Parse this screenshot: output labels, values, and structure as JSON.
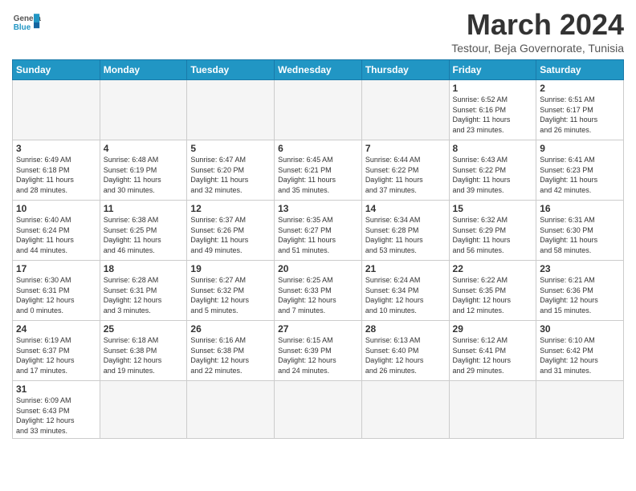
{
  "header": {
    "logo_general": "General",
    "logo_blue": "Blue",
    "month_title": "March 2024",
    "subtitle": "Testour, Beja Governorate, Tunisia"
  },
  "days_of_week": [
    "Sunday",
    "Monday",
    "Tuesday",
    "Wednesday",
    "Thursday",
    "Friday",
    "Saturday"
  ],
  "weeks": [
    [
      {
        "day": "",
        "info": ""
      },
      {
        "day": "",
        "info": ""
      },
      {
        "day": "",
        "info": ""
      },
      {
        "day": "",
        "info": ""
      },
      {
        "day": "",
        "info": ""
      },
      {
        "day": "1",
        "info": "Sunrise: 6:52 AM\nSunset: 6:16 PM\nDaylight: 11 hours\nand 23 minutes."
      },
      {
        "day": "2",
        "info": "Sunrise: 6:51 AM\nSunset: 6:17 PM\nDaylight: 11 hours\nand 26 minutes."
      }
    ],
    [
      {
        "day": "3",
        "info": "Sunrise: 6:49 AM\nSunset: 6:18 PM\nDaylight: 11 hours\nand 28 minutes."
      },
      {
        "day": "4",
        "info": "Sunrise: 6:48 AM\nSunset: 6:19 PM\nDaylight: 11 hours\nand 30 minutes."
      },
      {
        "day": "5",
        "info": "Sunrise: 6:47 AM\nSunset: 6:20 PM\nDaylight: 11 hours\nand 32 minutes."
      },
      {
        "day": "6",
        "info": "Sunrise: 6:45 AM\nSunset: 6:21 PM\nDaylight: 11 hours\nand 35 minutes."
      },
      {
        "day": "7",
        "info": "Sunrise: 6:44 AM\nSunset: 6:22 PM\nDaylight: 11 hours\nand 37 minutes."
      },
      {
        "day": "8",
        "info": "Sunrise: 6:43 AM\nSunset: 6:22 PM\nDaylight: 11 hours\nand 39 minutes."
      },
      {
        "day": "9",
        "info": "Sunrise: 6:41 AM\nSunset: 6:23 PM\nDaylight: 11 hours\nand 42 minutes."
      }
    ],
    [
      {
        "day": "10",
        "info": "Sunrise: 6:40 AM\nSunset: 6:24 PM\nDaylight: 11 hours\nand 44 minutes."
      },
      {
        "day": "11",
        "info": "Sunrise: 6:38 AM\nSunset: 6:25 PM\nDaylight: 11 hours\nand 46 minutes."
      },
      {
        "day": "12",
        "info": "Sunrise: 6:37 AM\nSunset: 6:26 PM\nDaylight: 11 hours\nand 49 minutes."
      },
      {
        "day": "13",
        "info": "Sunrise: 6:35 AM\nSunset: 6:27 PM\nDaylight: 11 hours\nand 51 minutes."
      },
      {
        "day": "14",
        "info": "Sunrise: 6:34 AM\nSunset: 6:28 PM\nDaylight: 11 hours\nand 53 minutes."
      },
      {
        "day": "15",
        "info": "Sunrise: 6:32 AM\nSunset: 6:29 PM\nDaylight: 11 hours\nand 56 minutes."
      },
      {
        "day": "16",
        "info": "Sunrise: 6:31 AM\nSunset: 6:30 PM\nDaylight: 11 hours\nand 58 minutes."
      }
    ],
    [
      {
        "day": "17",
        "info": "Sunrise: 6:30 AM\nSunset: 6:31 PM\nDaylight: 12 hours\nand 0 minutes."
      },
      {
        "day": "18",
        "info": "Sunrise: 6:28 AM\nSunset: 6:31 PM\nDaylight: 12 hours\nand 3 minutes."
      },
      {
        "day": "19",
        "info": "Sunrise: 6:27 AM\nSunset: 6:32 PM\nDaylight: 12 hours\nand 5 minutes."
      },
      {
        "day": "20",
        "info": "Sunrise: 6:25 AM\nSunset: 6:33 PM\nDaylight: 12 hours\nand 7 minutes."
      },
      {
        "day": "21",
        "info": "Sunrise: 6:24 AM\nSunset: 6:34 PM\nDaylight: 12 hours\nand 10 minutes."
      },
      {
        "day": "22",
        "info": "Sunrise: 6:22 AM\nSunset: 6:35 PM\nDaylight: 12 hours\nand 12 minutes."
      },
      {
        "day": "23",
        "info": "Sunrise: 6:21 AM\nSunset: 6:36 PM\nDaylight: 12 hours\nand 15 minutes."
      }
    ],
    [
      {
        "day": "24",
        "info": "Sunrise: 6:19 AM\nSunset: 6:37 PM\nDaylight: 12 hours\nand 17 minutes."
      },
      {
        "day": "25",
        "info": "Sunrise: 6:18 AM\nSunset: 6:38 PM\nDaylight: 12 hours\nand 19 minutes."
      },
      {
        "day": "26",
        "info": "Sunrise: 6:16 AM\nSunset: 6:38 PM\nDaylight: 12 hours\nand 22 minutes."
      },
      {
        "day": "27",
        "info": "Sunrise: 6:15 AM\nSunset: 6:39 PM\nDaylight: 12 hours\nand 24 minutes."
      },
      {
        "day": "28",
        "info": "Sunrise: 6:13 AM\nSunset: 6:40 PM\nDaylight: 12 hours\nand 26 minutes."
      },
      {
        "day": "29",
        "info": "Sunrise: 6:12 AM\nSunset: 6:41 PM\nDaylight: 12 hours\nand 29 minutes."
      },
      {
        "day": "30",
        "info": "Sunrise: 6:10 AM\nSunset: 6:42 PM\nDaylight: 12 hours\nand 31 minutes."
      }
    ],
    [
      {
        "day": "31",
        "info": "Sunrise: 6:09 AM\nSunset: 6:43 PM\nDaylight: 12 hours\nand 33 minutes."
      },
      {
        "day": "",
        "info": ""
      },
      {
        "day": "",
        "info": ""
      },
      {
        "day": "",
        "info": ""
      },
      {
        "day": "",
        "info": ""
      },
      {
        "day": "",
        "info": ""
      },
      {
        "day": "",
        "info": ""
      }
    ]
  ]
}
